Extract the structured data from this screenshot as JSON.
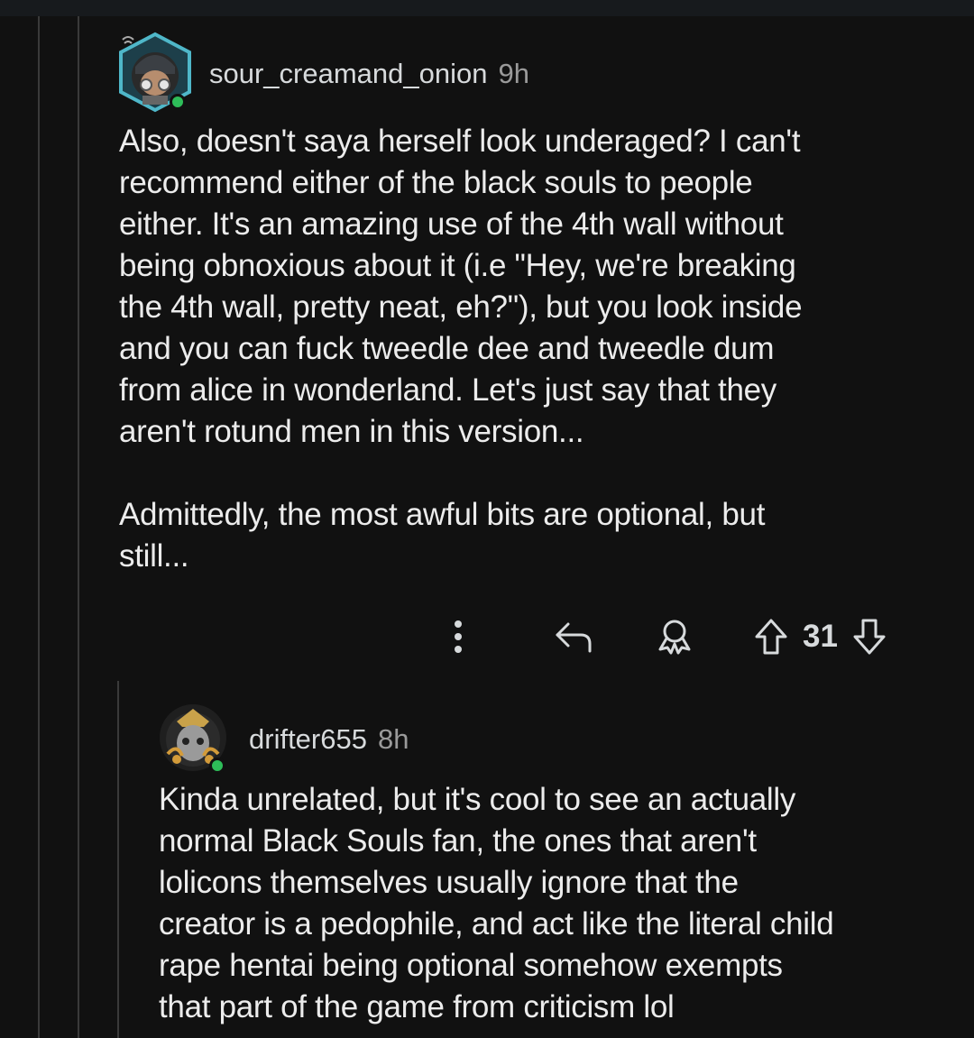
{
  "comment1": {
    "username": "sour_creamand_onion",
    "timestamp": "9h",
    "body": "Also, doesn't saya herself look underaged? I can't\nrecommend either of the black souls to people\neither. It's an amazing use of the 4th wall without\nbeing obnoxious about it (i.e \"Hey, we're breaking\nthe 4th wall, pretty neat, eh?\"), but you look inside\nand you can fuck tweedle dee and tweedle dum\nfrom alice in wonderland. Let's just say that they\naren't rotund men in this version...\n\nAdmittedly, the most awful bits are optional, but\nstill...",
    "votes": "31",
    "actions": {
      "more": "more-options-icon",
      "reply": "reply-icon",
      "award": "award-icon",
      "upvote": "upvote-icon",
      "downvote": "downvote-icon"
    }
  },
  "comment2": {
    "username": "drifter655",
    "timestamp": "8h",
    "body": "Kinda unrelated, but it's cool to see an actually\nnormal Black Souls fan, the ones that aren't\nlolicons themselves usually ignore that the\ncreator is a pedophile, and act like the literal child\nrape hentai being optional somehow exempts\nthat part of the game from criticism lol"
  },
  "colors": {
    "background": "#111111",
    "online": "#2ebd59",
    "text": "#ececec",
    "muted": "#9a9a9a"
  }
}
